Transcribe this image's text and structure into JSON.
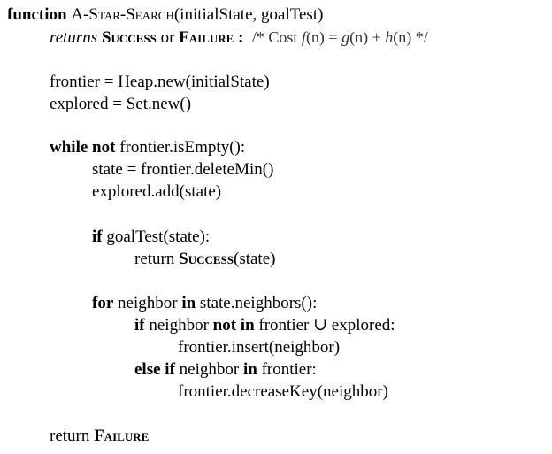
{
  "algorithm": {
    "line1": {
      "kw_function": "function",
      "name": "A-Star-Search",
      "params": "(initialState, goalTest)"
    },
    "line2": {
      "kw_returns": "returns",
      "success": "Success",
      "kw_or": "or",
      "failure": "Failure",
      "colon": ":",
      "comment_open": "/* Cost",
      "f": "f",
      "n1": "(n) =",
      "g": "g",
      "n2": "(n) +",
      "h": "h",
      "n3": "(n)",
      "comment_close": "*/"
    },
    "line3": "frontier = Heap.new(initialState)",
    "line4": "explored = Set.new()",
    "line5": {
      "kw_while": "while",
      "kw_not": "not",
      "rest": "frontier.isEmpty():"
    },
    "line6": "state = frontier.deleteMin()",
    "line7": "explored.add(state)",
    "line8": {
      "kw_if": "if",
      "rest": "goalTest(state):"
    },
    "line9": {
      "kw_return": "return",
      "success": "Success",
      "args": "(state)"
    },
    "line10": {
      "kw_for": "for",
      "var": "neighbor",
      "kw_in": "in",
      "rest": "state.neighbors():"
    },
    "line11": {
      "kw_if": "if",
      "var": "neighbor",
      "kw_not_in": "not in",
      "rest": "frontier ∪ explored:"
    },
    "line12": "frontier.insert(neighbor)",
    "line13": {
      "kw_else_if": "else if",
      "var": "neighbor",
      "kw_in": "in",
      "rest": "frontier:"
    },
    "line14": "frontier.decreaseKey(neighbor)",
    "line15": {
      "kw_return": "return",
      "failure": "Failure"
    }
  }
}
